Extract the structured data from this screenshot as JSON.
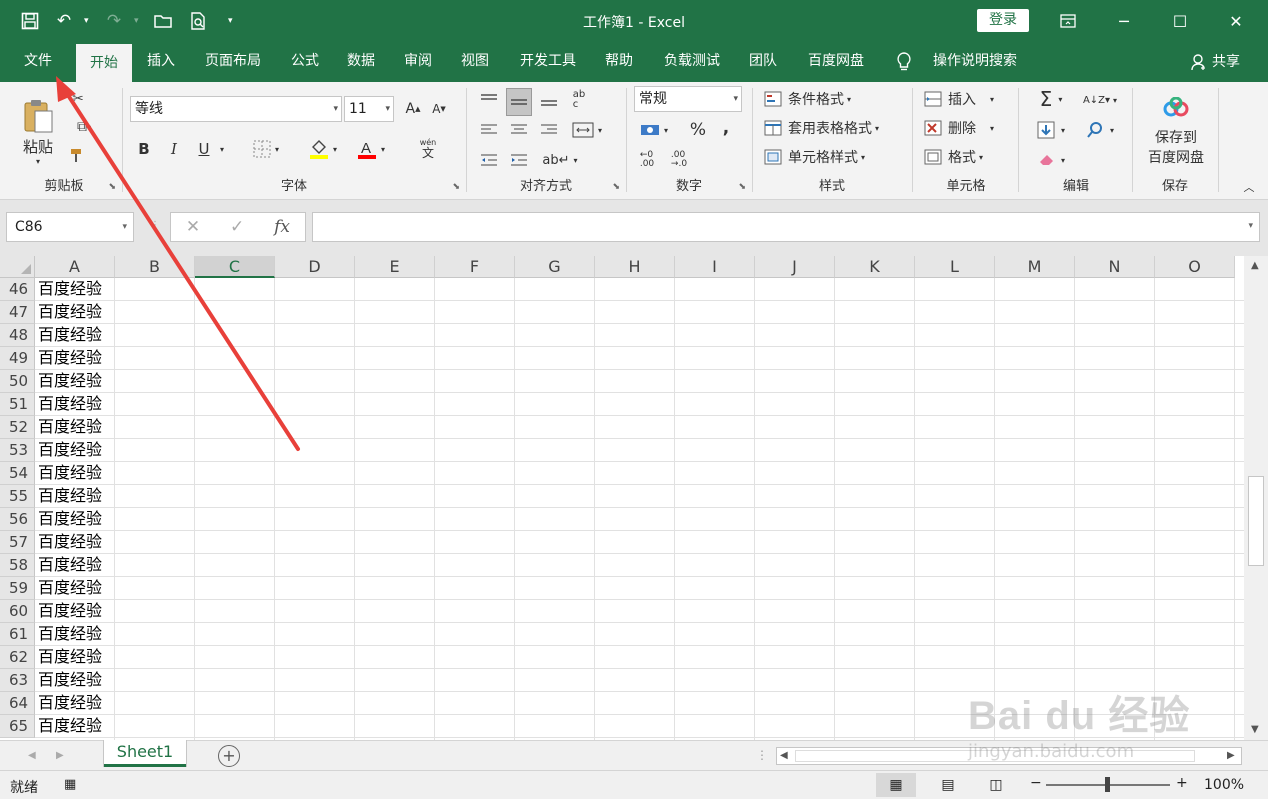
{
  "titlebar": {
    "doc_title": "工作簿1 - Excel",
    "login_label": "登录",
    "qat_icons": [
      "save-icon",
      "undo-icon",
      "redo-icon",
      "open-icon",
      "print-preview-icon",
      "customize-icon"
    ]
  },
  "menu": {
    "tabs": [
      "文件",
      "开始",
      "插入",
      "页面布局",
      "公式",
      "数据",
      "审阅",
      "视图",
      "开发工具",
      "帮助",
      "负载测试",
      "团队",
      "百度网盘"
    ],
    "active_tab": "开始",
    "tell_me": "操作说明搜索",
    "share": "共享"
  },
  "ribbon": {
    "clipboard": {
      "label": "剪贴板",
      "paste": "粘贴"
    },
    "font": {
      "label": "字体",
      "name": "等线",
      "size": "11",
      "bold": "B",
      "italic": "I",
      "underline": "U",
      "phonetic": "wén",
      "phonetic2": "文",
      "font_color": "#FF0000",
      "fill_color": "#FFFF00"
    },
    "alignment": {
      "label": "对齐方式"
    },
    "number": {
      "label": "数字",
      "format": "常规",
      "percent": "%",
      "comma": ","
    },
    "styles": {
      "label": "样式",
      "conditional": "条件格式",
      "table": "套用表格格式",
      "cell": "单元格样式"
    },
    "cells": {
      "label": "单元格",
      "insert": "插入",
      "delete": "删除",
      "format": "格式"
    },
    "editing": {
      "label": "编辑"
    },
    "save": {
      "label": "保存",
      "button_line1": "保存到",
      "button_line2": "百度网盘"
    }
  },
  "formula_bar": {
    "name_box": "C86",
    "fx": "fx",
    "formula": ""
  },
  "grid": {
    "columns": [
      "A",
      "B",
      "C",
      "D",
      "E",
      "F",
      "G",
      "H",
      "I",
      "J",
      "K",
      "L",
      "M",
      "N",
      "O"
    ],
    "selected_column": "C",
    "rows": [
      {
        "n": "46",
        "a": "百度经验"
      },
      {
        "n": "47",
        "a": "百度经验"
      },
      {
        "n": "48",
        "a": "百度经验"
      },
      {
        "n": "49",
        "a": "百度经验"
      },
      {
        "n": "50",
        "a": "百度经验"
      },
      {
        "n": "51",
        "a": "百度经验"
      },
      {
        "n": "52",
        "a": "百度经验"
      },
      {
        "n": "53",
        "a": "百度经验"
      },
      {
        "n": "54",
        "a": "百度经验"
      },
      {
        "n": "55",
        "a": "百度经验"
      },
      {
        "n": "56",
        "a": "百度经验"
      },
      {
        "n": "57",
        "a": "百度经验"
      },
      {
        "n": "58",
        "a": "百度经验"
      },
      {
        "n": "59",
        "a": "百度经验"
      },
      {
        "n": "60",
        "a": "百度经验"
      },
      {
        "n": "61",
        "a": "百度经验"
      },
      {
        "n": "62",
        "a": "百度经验"
      },
      {
        "n": "63",
        "a": "百度经验"
      },
      {
        "n": "64",
        "a": "百度经验"
      },
      {
        "n": "65",
        "a": "百度经验"
      }
    ]
  },
  "sheets": {
    "tabs": [
      "Sheet1"
    ],
    "add": "+"
  },
  "status": {
    "ready": "就绪",
    "zoom": "100%",
    "minus": "−",
    "plus": "+"
  },
  "watermark": {
    "brand": "Bai du 经验",
    "url": "jingyan.baidu.com"
  },
  "accent": "#217346"
}
